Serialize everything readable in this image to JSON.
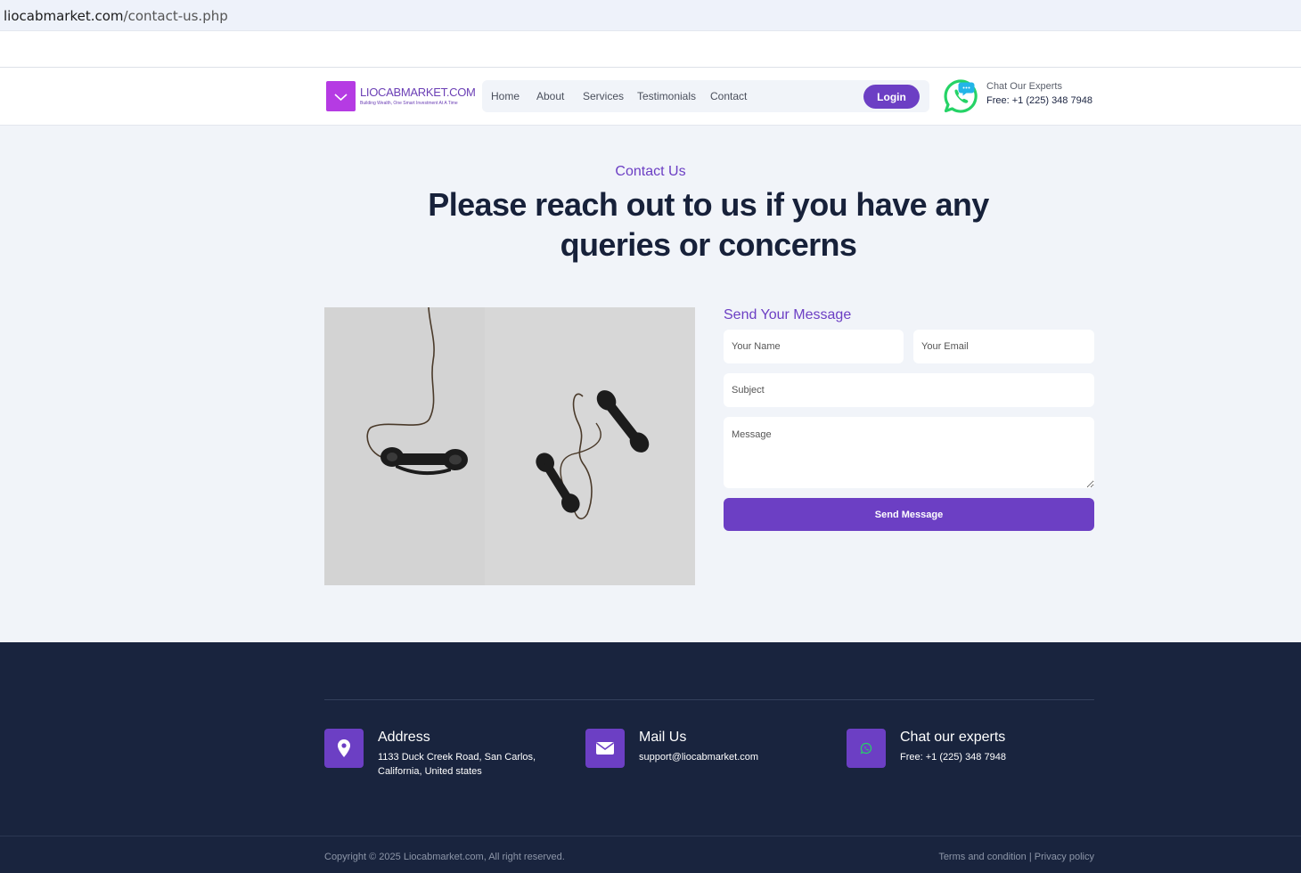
{
  "browser": {
    "url_host": "liocabmarket.com",
    "url_path": "/contact-us.php"
  },
  "header": {
    "logo_name": "LIOCABMARKET.COM",
    "logo_tagline": "Building Wealth, One Smart Investment At A Time",
    "nav": [
      "Home",
      "About",
      "Services",
      "Testimonials",
      "Contact"
    ],
    "login_label": "Login",
    "chat_label": "Chat Our Experts",
    "chat_phone": "Free: +1 (225) 348 7948"
  },
  "hero": {
    "eyebrow": "Contact Us",
    "headline": "Please reach out to us if you have any queries or concerns"
  },
  "form": {
    "title": "Send Your Message",
    "name_placeholder": "Your Name",
    "email_placeholder": "Your Email",
    "subject_placeholder": "Subject",
    "message_placeholder": "Message",
    "submit_label": "Send Message"
  },
  "footer": {
    "address": {
      "title": "Address",
      "line1": "1133 Duck Creek Road, San Carlos,",
      "line2": "California, United states"
    },
    "mail": {
      "title": "Mail Us",
      "text": "support@liocabmarket.com"
    },
    "chat": {
      "title": "Chat our experts",
      "text": "Free: +1 (225) 348 7948"
    },
    "copyright": "Copyright © 2025 Liocabmarket.com, All right reserved.",
    "terms": "Terms and condition",
    "separator": "|",
    "privacy": "Privacy policy"
  },
  "colors": {
    "accent": "#6c3fc4",
    "logo_mark": "#b53be3",
    "page_bg": "#f1f4f9",
    "footer_bg": "#19243e",
    "whatsapp": "#25d366"
  },
  "icons": [
    "chevron-down-icon",
    "whatsapp-icon",
    "map-pin-icon",
    "envelope-icon"
  ]
}
